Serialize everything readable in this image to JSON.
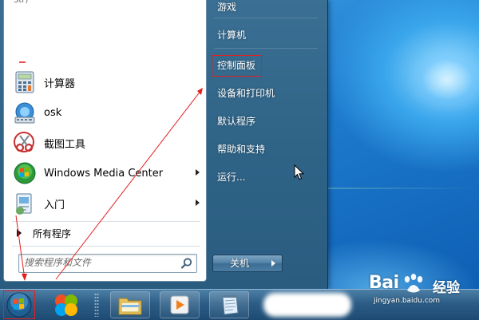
{
  "start_menu": {
    "recent_partial_label": "Str)",
    "programs": [
      {
        "label": "计算器",
        "icon": "calculator-icon"
      },
      {
        "label": "osk",
        "icon": "keyboard-icon"
      },
      {
        "label": "截图工具",
        "icon": "scissors-icon"
      },
      {
        "label": "Windows Media Center",
        "icon": "media-center-icon",
        "has_submenu": true
      },
      {
        "label": "入门",
        "icon": "getting-started-icon",
        "has_submenu": true
      }
    ],
    "all_programs_label": "所有程序",
    "search": {
      "placeholder": "搜索程序和文件"
    },
    "right_items": [
      "游戏",
      "计算机",
      "控制面板",
      "设备和打印机",
      "默认程序",
      "帮助和支持",
      "运行..."
    ],
    "highlighted_item": "控制面板",
    "shutdown_label": "关机"
  },
  "taskbar": {
    "items": [
      "start-orb-icon",
      "media-player-icon",
      "explorer-folder-icon",
      "media-playlist-icon",
      "notepad-icon"
    ]
  },
  "watermark": {
    "brand": "Bai",
    "text": "经验",
    "url": "jingyan.baidu.com"
  },
  "colors": {
    "annotation": "#e21f1f",
    "menu_right_pane": "#2f6487",
    "taskbar": "#2c5d86"
  }
}
